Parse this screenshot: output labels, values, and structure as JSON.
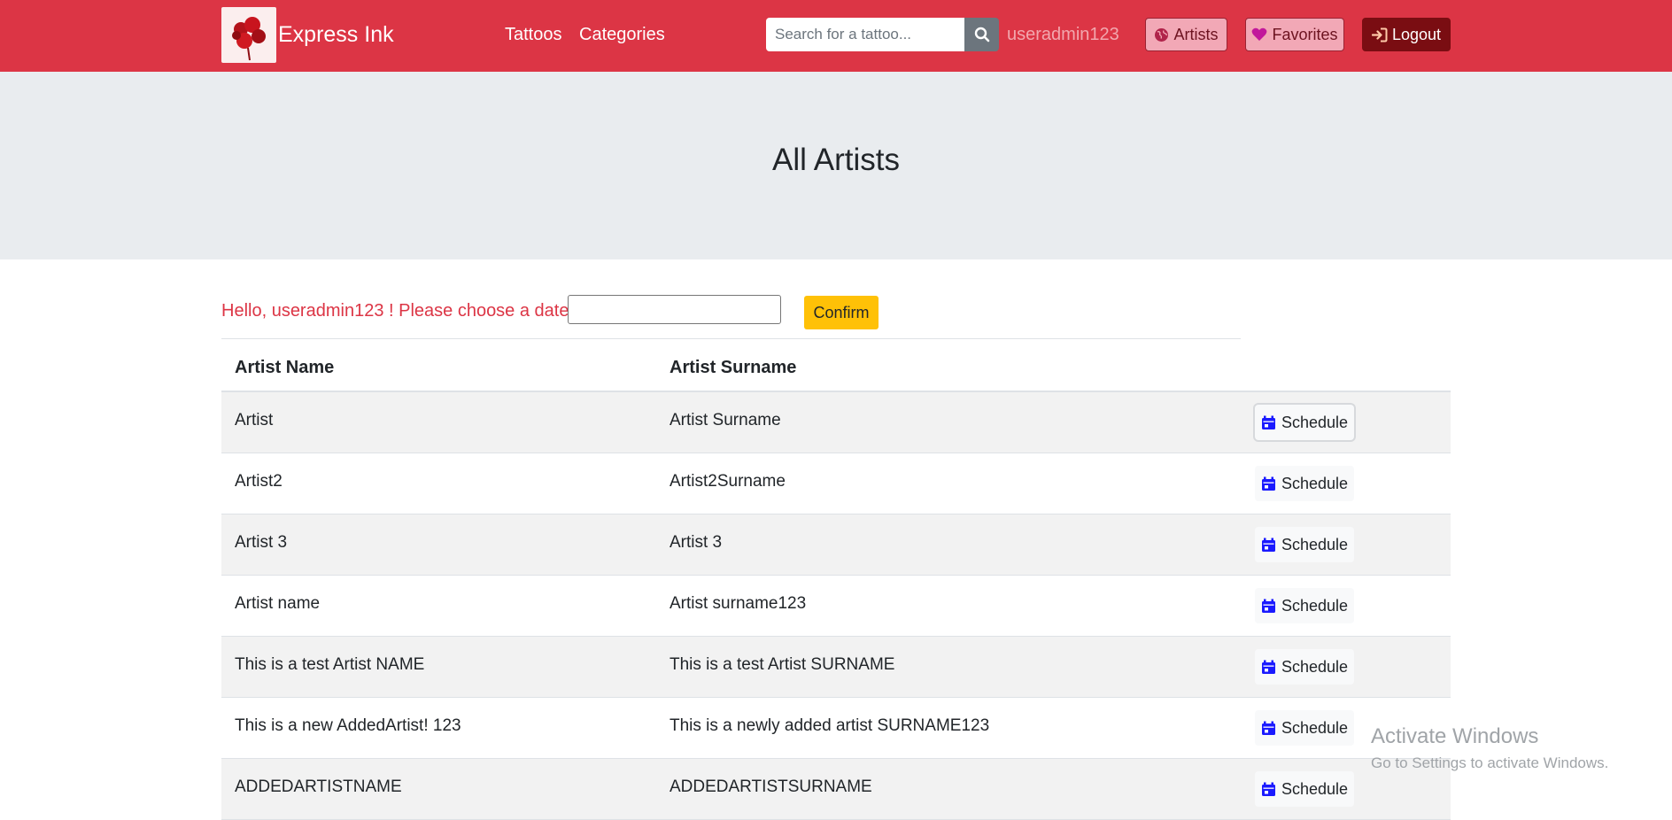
{
  "navbar": {
    "brand": "Express Ink",
    "links": [
      "Tattoos",
      "Categories"
    ],
    "search_placeholder": "Search for a tattoo...",
    "username": "useradmin123",
    "artists_label": "Artists",
    "favorites_label": "Favorites",
    "logout_label": "Logout"
  },
  "page": {
    "title": "All Artists",
    "greeting": "Hello, useradmin123 ! Please choose a date:",
    "confirm_label": "Confirm"
  },
  "table": {
    "headers": [
      "Artist Name",
      "Artist Surname"
    ],
    "schedule_label": "Schedule",
    "rows": [
      [
        "Artist",
        "Artist Surname"
      ],
      [
        "Artist2",
        "Artist2Surname"
      ],
      [
        "Artist 3",
        "Artist 3"
      ],
      [
        "Artist name",
        "Artist surname123"
      ],
      [
        "This is a test Artist NAME",
        "This is a test Artist SURNAME"
      ],
      [
        "This is a new AddedArtist! 123",
        "This is a newly added artist SURNAME123"
      ],
      [
        "ADDEDARTISTNAME",
        "ADDEDARTISTSURNAME"
      ]
    ]
  },
  "watermark": {
    "title": "Activate Windows",
    "subtitle": "Go to Settings to activate Windows."
  },
  "colors": {
    "navbar": "#dc3545",
    "confirm": "#ffc107",
    "logout": "#7a0d12",
    "calendar_icon": "#1a1aff"
  },
  "icons": [
    "search-icon",
    "globe-icon",
    "heart-icon",
    "sign-in-icon",
    "calendar-icon"
  ]
}
